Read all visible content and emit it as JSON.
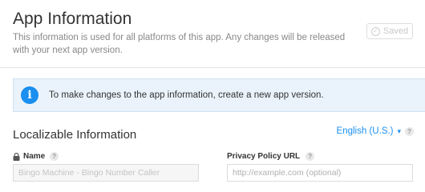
{
  "header": {
    "title": "App Information",
    "description": "This information is used for all platforms of this app. Any changes will be released with your next app version.",
    "saved_label": "Saved"
  },
  "banner": {
    "icon": "info-icon",
    "text": "To make changes to the app information, create a new app version."
  },
  "section": {
    "title": "Localizable Information",
    "language": "English (U.S.)",
    "help": "?"
  },
  "fields": {
    "name": {
      "label": "Name",
      "help": "?",
      "value": "Bingo Machine - Bingo Number Caller",
      "locked": true
    },
    "privacy": {
      "label": "Privacy Policy URL",
      "help": "?",
      "placeholder": "http://example.com (optional)"
    }
  },
  "colors": {
    "accent": "#1a8ff0",
    "banner_bg": "#eaf3fb"
  }
}
